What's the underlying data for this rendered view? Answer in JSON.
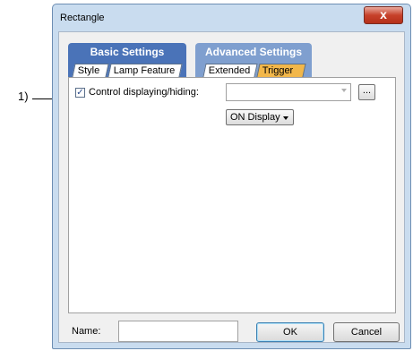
{
  "callout": {
    "label": "1)"
  },
  "window": {
    "title": "Rectangle",
    "close_glyph": "x"
  },
  "tab_groups": [
    {
      "title": "Basic Settings",
      "tabs": [
        "Style",
        "Lamp Feature"
      ]
    },
    {
      "title": "Advanced Settings",
      "tabs": [
        "Extended",
        "Trigger"
      ]
    }
  ],
  "active_tab": "Trigger",
  "trigger": {
    "control_checkbox": {
      "label": "Control displaying/hiding:",
      "checked": true,
      "check_glyph": "✓"
    },
    "device_combo": {
      "value": ""
    },
    "browse_button": {
      "label": "..."
    },
    "display_dropdown": {
      "selected": "ON Display"
    }
  },
  "footer": {
    "name_label": "Name:",
    "name_value": "",
    "ok_label": "OK",
    "cancel_label": "Cancel"
  },
  "colors": {
    "window_frame": "#c9dcef",
    "basic_tab_group": "#4a73b8",
    "advanced_tab_group": "#7f9fcf",
    "active_tab": "#f2b74a",
    "close_button": "#c7412a"
  },
  "icons": {
    "close": "close-icon",
    "browse": "ellipsis-icon",
    "dropdown": "chevron-down-icon"
  }
}
